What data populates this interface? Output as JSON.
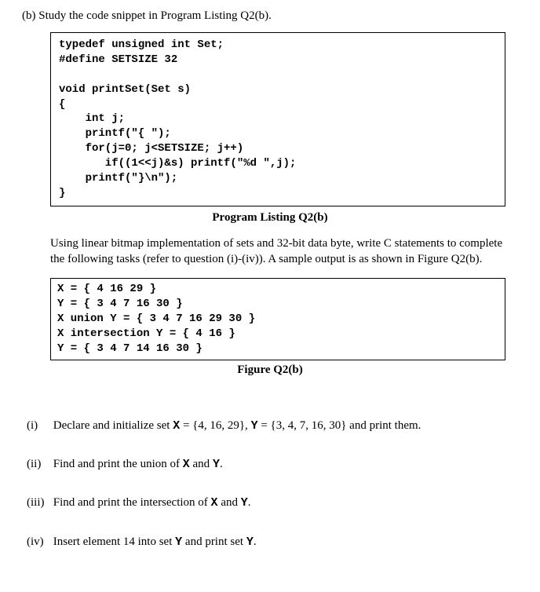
{
  "header": {
    "label": "(b) Study the code snippet in Program Listing Q2(b)."
  },
  "code": {
    "l1": "typedef unsigned int Set;",
    "l2": "#define SETSIZE 32",
    "l3": "",
    "l4": "void printSet(Set s)",
    "l5": "{",
    "l6": "    int j;",
    "l7": "    printf(\"{ \");",
    "l8": "    for(j=0; j<SETSIZE; j++)",
    "l9": "       if((1<<j)&s) printf(\"%d \",j);",
    "l10": "    printf(\"}\\n\");",
    "l11": "}"
  },
  "caption1": "Program Listing Q2(b)",
  "para1": "Using linear bitmap implementation of sets and 32-bit data byte, write C statements to complete the following tasks (refer to question (i)-(iv)). A sample output is as shown in Figure Q2(b).",
  "output": {
    "l1": "X = { 4 16 29 }",
    "l2": "Y = { 3 4 7 16 30 }",
    "l3": "X union Y = { 3 4 7 16 29 30 }",
    "l4": "X intersection Y = { 4 16 }",
    "l5": "Y = { 3 4 7 14 16 30 }"
  },
  "caption2": "Figure Q2(b)",
  "subq": {
    "i": {
      "num": "(i)",
      "pre": "Declare and initialize set ",
      "x": "X",
      "eq1": " = {4, 16, 29}, ",
      "y": "Y",
      "eq2": " = {3, 4, 7, 16, 30} and print them."
    },
    "ii": {
      "num": "(ii)",
      "pre": "Find and print the union of ",
      "x": "X",
      "mid": " and ",
      "y": "Y",
      "post": "."
    },
    "iii": {
      "num": "(iii)",
      "pre": "Find and print the intersection of ",
      "x": "X",
      "mid": " and ",
      "y": "Y",
      "post": "."
    },
    "iv": {
      "num": "(iv)",
      "pre": "Insert element 14 into set  ",
      "y1": "Y",
      "mid": "  and print set ",
      "y2": "Y",
      "post": "."
    }
  }
}
